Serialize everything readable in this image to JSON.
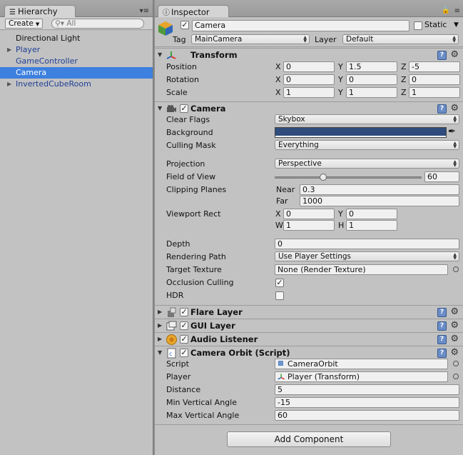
{
  "hierarchy": {
    "tab_label": "Hierarchy",
    "create_label": "Create",
    "search_placeholder": "All",
    "items": [
      {
        "label": "Directional Light",
        "blue": false,
        "selected": false,
        "foldable": false
      },
      {
        "label": "Player",
        "blue": true,
        "selected": false,
        "foldable": true
      },
      {
        "label": "GameController",
        "blue": true,
        "selected": false,
        "foldable": false
      },
      {
        "label": "Camera",
        "blue": false,
        "selected": true,
        "foldable": false
      },
      {
        "label": "InvertedCubeRoom",
        "blue": true,
        "selected": false,
        "foldable": true
      }
    ]
  },
  "inspector": {
    "tab_label": "Inspector",
    "object_name": "Camera",
    "active": true,
    "static_label": "Static",
    "static": false,
    "tag_label": "Tag",
    "tag_value": "MainCamera",
    "layer_label": "Layer",
    "layer_value": "Default",
    "transform": {
      "title": "Transform",
      "position_label": "Position",
      "rotation_label": "Rotation",
      "scale_label": "Scale",
      "position": {
        "x": "0",
        "y": "1.5",
        "z": "-5"
      },
      "rotation": {
        "x": "0",
        "y": "0",
        "z": "0"
      },
      "scale": {
        "x": "1",
        "y": "1",
        "z": "1"
      },
      "axis_x": "X",
      "axis_y": "Y",
      "axis_z": "Z"
    },
    "camera": {
      "title": "Camera",
      "clear_flags_label": "Clear Flags",
      "clear_flags": "Skybox",
      "background_label": "Background",
      "background_color": "#2f4c7c",
      "culling_mask_label": "Culling Mask",
      "culling_mask": "Everything",
      "projection_label": "Projection",
      "projection": "Perspective",
      "fov_label": "Field of View",
      "fov": "60",
      "fov_fraction": 0.33,
      "clipping_label": "Clipping Planes",
      "near_label": "Near",
      "near": "0.3",
      "far_label": "Far",
      "far": "1000",
      "viewport_label": "Viewport Rect",
      "viewport": {
        "x": "0",
        "y": "0",
        "w": "1",
        "h": "1"
      },
      "vp_x": "X",
      "vp_y": "Y",
      "vp_w": "W",
      "vp_h": "H",
      "depth_label": "Depth",
      "depth": "0",
      "rendering_path_label": "Rendering Path",
      "rendering_path": "Use Player Settings",
      "target_texture_label": "Target Texture",
      "target_texture": "None (Render Texture)",
      "occlusion_label": "Occlusion Culling",
      "occlusion": true,
      "hdr_label": "HDR",
      "hdr": false
    },
    "flare_layer": {
      "title": "Flare Layer",
      "enabled": true
    },
    "gui_layer": {
      "title": "GUI Layer",
      "enabled": true
    },
    "audio_listener": {
      "title": "Audio Listener",
      "enabled": true
    },
    "camera_orbit": {
      "title": "Camera Orbit (Script)",
      "script_label": "Script",
      "script": "CameraOrbit",
      "player_label": "Player",
      "player": "Player (Transform)",
      "distance_label": "Distance",
      "distance": "5",
      "min_angle_label": "Min Vertical Angle",
      "min_angle": "-15",
      "max_angle_label": "Max Vertical Angle",
      "max_angle": "60"
    },
    "add_component_label": "Add Component"
  }
}
